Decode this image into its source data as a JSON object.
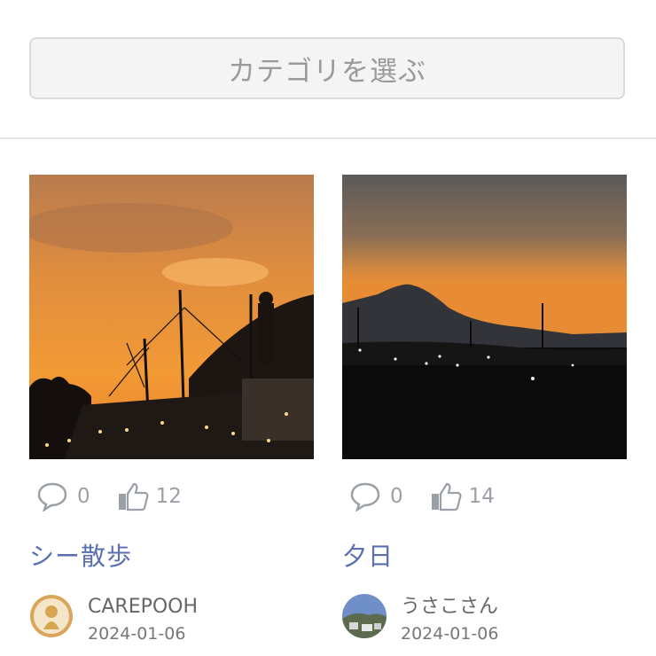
{
  "category": {
    "placeholder": "カテゴリを選ぶ"
  },
  "posts": [
    {
      "title": "シー散歩",
      "comments": "0",
      "likes": "12",
      "author": "CAREPOOH",
      "date": "2024-01-06",
      "image": "sunset-harbor-ship-photo",
      "avatar": "gold-character-avatar"
    },
    {
      "title": "夕日",
      "comments": "0",
      "likes": "14",
      "author": "うさこさん",
      "date": "2024-01-06",
      "image": "mount-fuji-sunset-photo",
      "avatar": "town-landscape-avatar"
    }
  ],
  "icons": {
    "comment": "comment-bubble-icon",
    "like": "thumbs-up-icon"
  },
  "colors": {
    "title": "#5a6fb0",
    "stat": "#9aa0a6",
    "placeholder": "#9a9a9a"
  }
}
